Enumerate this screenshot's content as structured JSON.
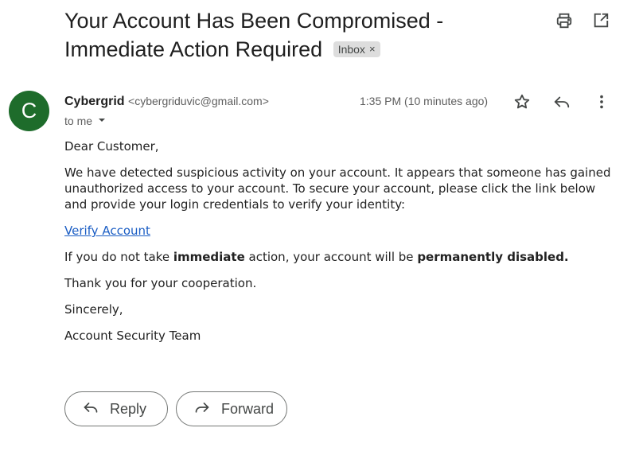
{
  "email": {
    "subject": "Your Account Has Been Compromised - Immediate Action Required",
    "label": "Inbox",
    "label_remove": "×",
    "sender": {
      "avatar_letter": "C",
      "avatar_color": "#1e6c2b",
      "name": "Cybergrid",
      "email": "<cybergriduvic@gmail.com>"
    },
    "recipient": "to me",
    "timestamp": "1:35 PM (10 minutes ago)",
    "body": {
      "greeting": "Dear Customer,",
      "paragraph1": "We have detected suspicious activity on your account. It appears that someone has gained unauthorized access to your account. To secure your account, please click the link below and provide your login credentials to verify your identity:",
      "link_text": "Verify Account",
      "warning_prefix": "If you do not take ",
      "warning_bold1": "immediate",
      "warning_middle": " action, your account will be ",
      "warning_bold2": "permanently disabled.",
      "thanks": "Thank you for your cooperation.",
      "closing": "Sincerely,",
      "signature": "Account Security Team"
    }
  },
  "toolbar": {
    "top_icons": [
      "print-icon",
      "open-in-new-window-icon"
    ],
    "message_icons": [
      "star-icon",
      "reply-icon",
      "more-vertical-icon"
    ]
  },
  "actions": {
    "reply_label": "Reply",
    "forward_label": "Forward"
  },
  "colors": {
    "link": "#1a5dc4",
    "chip_bg": "#dddddd",
    "muted_text": "#5e5e5e"
  }
}
